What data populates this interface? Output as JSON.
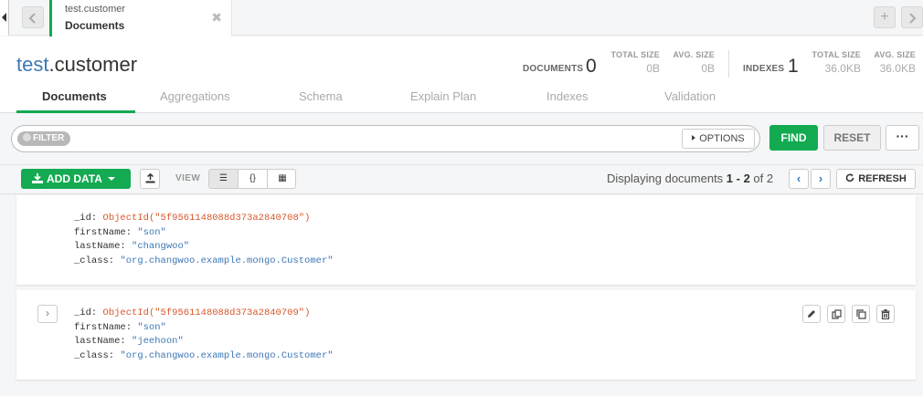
{
  "tab": {
    "namespace": "test.customer",
    "subtitle": "Documents",
    "close_glyph": "✖",
    "new_tab_glyph": "+"
  },
  "header": {
    "title_db": "test",
    "title_coll": ".customer",
    "documents_label": "DOCUMENTS",
    "documents_count": "0",
    "total_size_label": "TOTAL SIZE",
    "total_size_value": "0B",
    "avg_size_label": "AVG. SIZE",
    "avg_size_value": "0B",
    "indexes_label": "INDEXES",
    "indexes_count": "1",
    "idx_total_size_label": "TOTAL SIZE",
    "idx_total_size_value": "36.0KB",
    "idx_avg_size_label": "AVG. SIZE",
    "idx_avg_size_value": "36.0KB"
  },
  "subtabs": [
    {
      "label": "Documents",
      "active": true
    },
    {
      "label": "Aggregations"
    },
    {
      "label": "Schema"
    },
    {
      "label": "Explain Plan"
    },
    {
      "label": "Indexes"
    },
    {
      "label": "Validation"
    }
  ],
  "query": {
    "filter_label": "FILTER",
    "filter_value": "",
    "options_label": "OPTIONS",
    "find_label": "FIND",
    "reset_label": "RESET",
    "more_label": "···"
  },
  "toolbar": {
    "add_data_label": "ADD DATA",
    "view_label": "VIEW",
    "view_list": "☰",
    "view_json": "{}",
    "view_table": "▦",
    "displaying_prefix": "Displaying documents ",
    "displaying_range": "1 - 2",
    "displaying_of": " of ",
    "displaying_total": "2",
    "prev_glyph": "‹",
    "next_glyph": "›",
    "refresh_label": "REFRESH"
  },
  "documents": [
    {
      "id_key": "_id:",
      "id_val": "ObjectId(\"5f9561148088d373a2840708\")",
      "first_key": "firstName:",
      "first_val": "\"son\"",
      "last_key": "lastName:",
      "last_val": "\"changwoo\"",
      "class_key": "_class:",
      "class_val": "\"org.changwoo.example.mongo.Customer\""
    },
    {
      "id_key": "_id:",
      "id_val": "ObjectId(\"5f9561148088d373a2840709\")",
      "first_key": "firstName:",
      "first_val": "\"son\"",
      "last_key": "lastName:",
      "last_val": "\"jeehoon\"",
      "class_key": "_class:",
      "class_val": "\"org.changwoo.example.mongo.Customer\"",
      "expand_glyph": "›"
    }
  ],
  "colors": {
    "accent_green": "#13aa52",
    "link_blue": "#3d78b5",
    "objectid_orange": "#d6582c"
  },
  "icons": {
    "edit": "pencil-icon",
    "copy": "copy-icon",
    "clone": "clone-icon",
    "delete": "trash-icon",
    "export": "upload-icon",
    "refresh": "refresh-icon",
    "download": "download-icon"
  }
}
